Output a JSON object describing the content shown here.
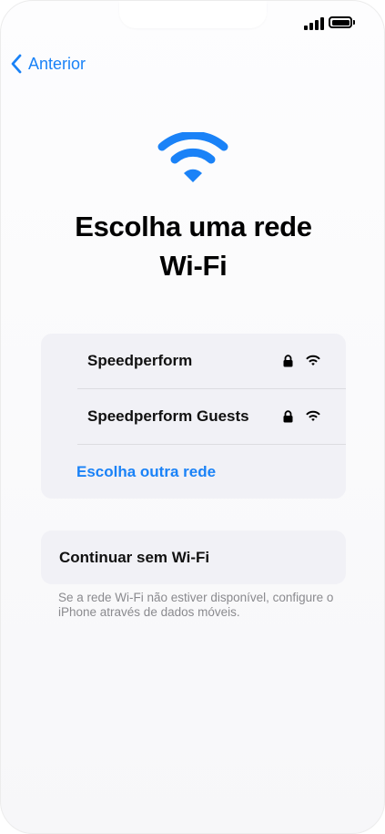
{
  "status_bar": {
    "signal_icon": "cellular-signal-icon",
    "battery_icon": "battery-full-icon"
  },
  "nav": {
    "back_label": "Anterior",
    "back_icon": "chevron-left-icon"
  },
  "hero": {
    "icon": "wifi-icon",
    "title_line1": "Escolha uma rede",
    "title_line2": "Wi-Fi"
  },
  "networks": [
    {
      "name": "Speedperform",
      "secured": true,
      "signal": "full"
    },
    {
      "name": "Speedperform Guests",
      "secured": true,
      "signal": "full"
    }
  ],
  "other_network_label": "Escolha outra rede",
  "continue_label": "Continuar sem Wi-Fi",
  "footnote": "Se a rede Wi-Fi não estiver disponível, configure o iPhone através de dados móveis.",
  "colors": {
    "accent": "#1a82f7",
    "group_background": "#f1f1f6",
    "secondary_text": "#8a8a8e"
  }
}
